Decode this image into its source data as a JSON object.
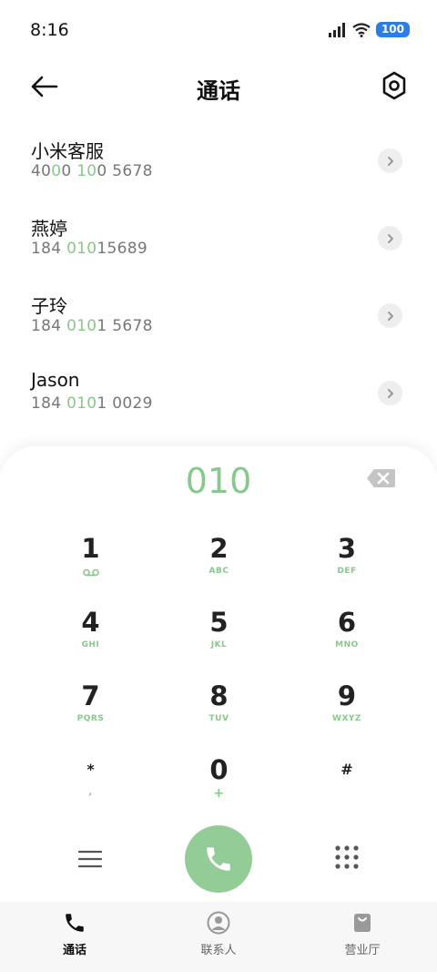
{
  "status": {
    "time": "8:16",
    "battery": "100"
  },
  "header": {
    "title": "通话"
  },
  "contacts": [
    {
      "name": "小米客服",
      "number_parts": [
        "40",
        "0",
        "0 ",
        "10",
        "0 5678"
      ]
    },
    {
      "name": "燕婷",
      "number_parts": [
        "184 ",
        "010",
        "15689"
      ]
    },
    {
      "name": "子玲",
      "number_parts": [
        "184 ",
        "010",
        "1 5678"
      ]
    },
    {
      "name": "Jason",
      "number_parts": [
        "184 ",
        "010",
        "1 0029"
      ]
    }
  ],
  "dialpad": {
    "input": "010",
    "keys": [
      {
        "digit": "1",
        "sub": ""
      },
      {
        "digit": "2",
        "sub": "ABC"
      },
      {
        "digit": "3",
        "sub": "DEF"
      },
      {
        "digit": "4",
        "sub": "GHI"
      },
      {
        "digit": "5",
        "sub": "JKL"
      },
      {
        "digit": "6",
        "sub": "MNO"
      },
      {
        "digit": "7",
        "sub": "PQRS"
      },
      {
        "digit": "8",
        "sub": "TUV"
      },
      {
        "digit": "9",
        "sub": "WXYZ"
      },
      {
        "digit": "*",
        "sub": ","
      },
      {
        "digit": "0",
        "sub": "+"
      },
      {
        "digit": "#",
        "sub": ""
      }
    ]
  },
  "nav": {
    "calls": "通话",
    "contacts": "联系人",
    "service": "营业厅"
  },
  "colors": {
    "accent": "#86c98a",
    "call_button": "#93cc96",
    "battery": "#2b7de9"
  }
}
